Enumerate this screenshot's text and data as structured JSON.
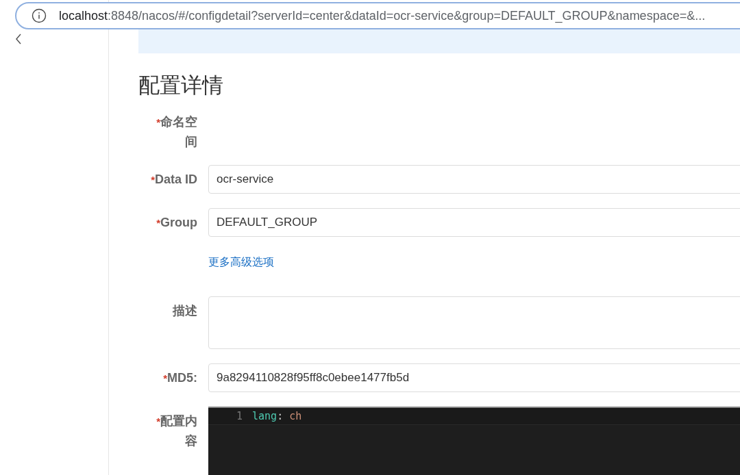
{
  "address_bar": {
    "host": "localhost",
    "path": ":8848/nacos/#/configdetail?serverId=center&dataId=ocr-service&group=DEFAULT_GROUP&namespace=&..."
  },
  "page": {
    "title": "配置详情"
  },
  "form": [
    {
      "kind": "label_only",
      "label": "命名空间",
      "required_mark": "*"
    },
    {
      "kind": "input",
      "label": "Data ID",
      "required_mark": "*",
      "value": "ocr-service"
    },
    {
      "kind": "input",
      "label": "Group",
      "required_mark": "*",
      "value": "DEFAULT_GROUP"
    },
    {
      "kind": "link",
      "text": "更多高级选项"
    },
    {
      "kind": "textarea",
      "label": "描述"
    },
    {
      "kind": "input",
      "label": "MD5:",
      "required_mark": "*",
      "value": "9a8294110828f95ff8c0ebee1477fb5d"
    },
    {
      "kind": "editor",
      "label": "配置内容",
      "required_mark": "*",
      "lines": [
        {
          "number": "1",
          "tokens": [
            {
              "text": "lang",
              "kind": "key"
            },
            {
              "text": ":",
              "kind": "punct"
            },
            {
              "text": "ch",
              "kind": "value"
            }
          ]
        }
      ]
    }
  ]
}
